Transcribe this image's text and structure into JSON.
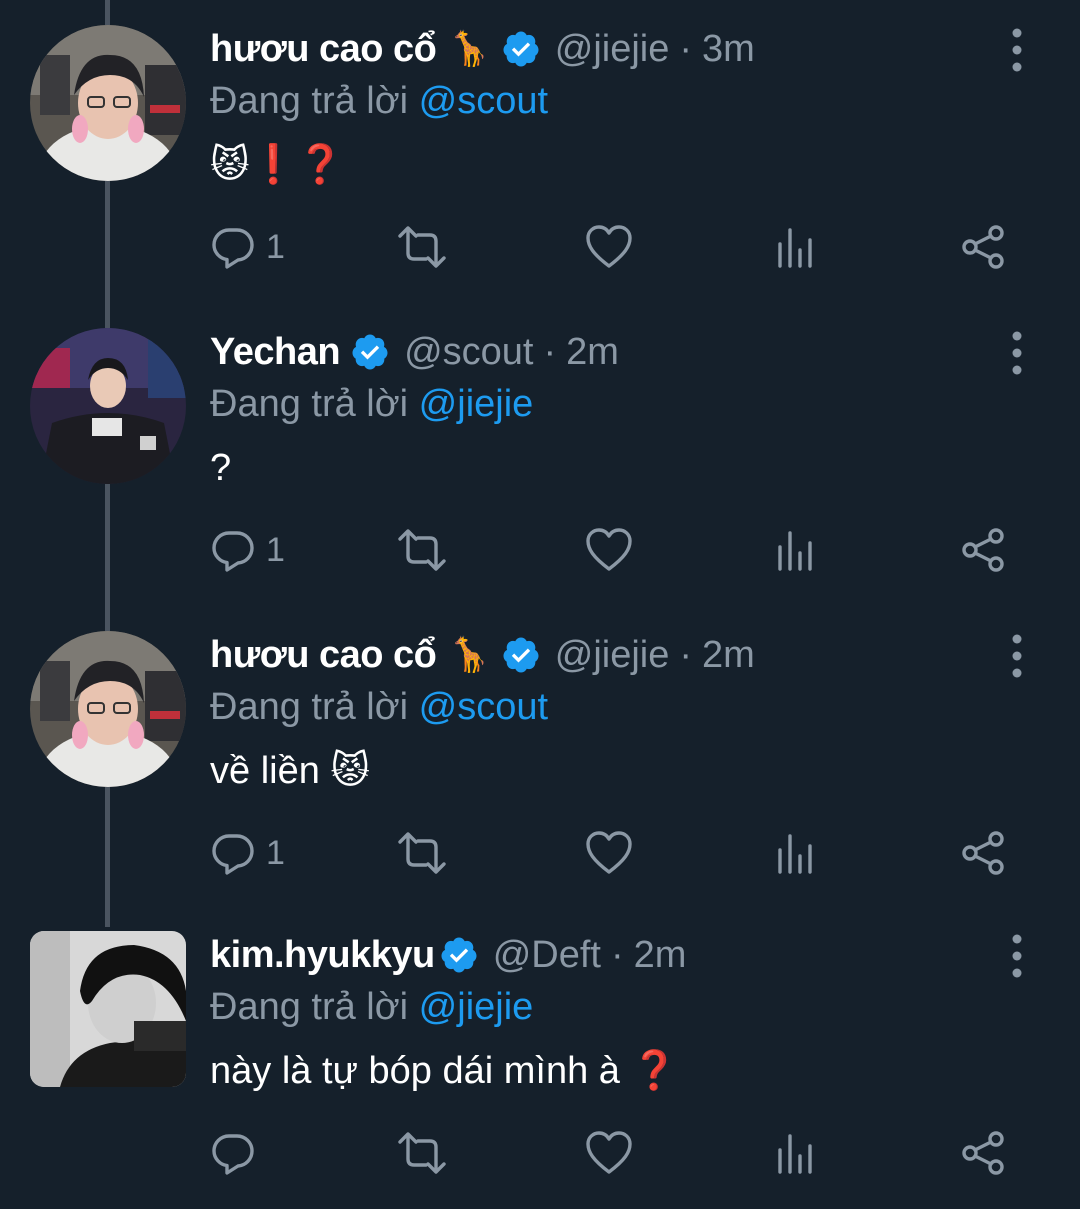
{
  "colors": {
    "background": "#15202b",
    "text_primary": "#ffffff",
    "text_secondary": "#8b98a5",
    "accent": "#1d9bf0",
    "thread_line": "#4a5460"
  },
  "tweets": [
    {
      "display_name": "hươu cao cổ",
      "name_emoji": "🦒",
      "verified": true,
      "handle": "@jiejie",
      "separator": "·",
      "time": "3m",
      "reply_prefix": "Đang trả lời",
      "reply_to": "@scout",
      "text": "😾❗❓",
      "reply_count": "1",
      "avatar_icon": "avatar-photo"
    },
    {
      "display_name": "Yechan",
      "name_emoji": "",
      "verified": true,
      "handle": "@scout",
      "separator": "·",
      "time": "2m",
      "reply_prefix": "Đang trả lời",
      "reply_to": "@jiejie",
      "text": "?",
      "reply_count": "1",
      "avatar_icon": "avatar-photo"
    },
    {
      "display_name": "hươu cao cổ",
      "name_emoji": "🦒",
      "verified": true,
      "handle": "@jiejie",
      "separator": "·",
      "time": "2m",
      "reply_prefix": "Đang trả lời",
      "reply_to": "@scout",
      "text": "về liền 😾",
      "reply_count": "1",
      "avatar_icon": "avatar-photo"
    },
    {
      "display_name": "kim.hyukkyu",
      "name_emoji": "",
      "verified": true,
      "handle": "@Deft",
      "separator": "·",
      "time": "2m",
      "reply_prefix": "Đang trả lời",
      "reply_to": "@jiejie",
      "text": "này là tự bóp dái mình à ❓",
      "reply_count": "",
      "avatar_icon": "avatar-photo"
    }
  ],
  "icons": {
    "reply": "reply-icon",
    "retweet": "retweet-icon",
    "like": "heart-icon",
    "views": "analytics-icon",
    "share": "share-icon",
    "more": "more-vertical-icon",
    "verified": "verified-badge-icon"
  }
}
